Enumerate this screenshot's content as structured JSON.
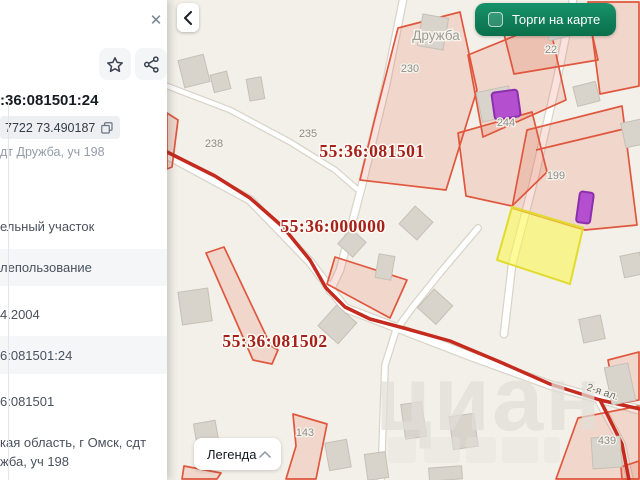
{
  "panel": {
    "title": ":36:081501:24",
    "coords_value": "7722 73.490187",
    "subtitle": "дт Дружба, уч 198",
    "row_type": "ельный участок",
    "row_landuse": "лепользование",
    "row_date": "4.2004",
    "row_cadnum": "6:081501:24",
    "row_quarter": "6:081501",
    "address_line1": "кая область, г Омск, сдт",
    "address_line2": "жба, уч 198"
  },
  "map": {
    "auction_button_label": "Торги на карте",
    "legend_button_label": "Легенда",
    "place_label": "Дружба",
    "street_label": "2-я ал.",
    "watermark": "циан",
    "quarter_labels": {
      "q081501": "55:36:081501",
      "q000000": "55:36:000000",
      "q081502": "55:36:081502"
    },
    "parcel_labels": {
      "p230": "230",
      "p238": "238",
      "p235": "235",
      "p244": "244",
      "p22": "22",
      "p199": "199",
      "p143": "143",
      "p439": "439"
    },
    "colors": {
      "map_background": "#f3f0e9",
      "parcel_stroke": "#e0573e",
      "quarter_boundary": "#c52a1e",
      "quarter_label_text": "#a6211a",
      "selected_parcel_fill": "#f9f68d",
      "selected_parcel_stroke": "#e0dc2e",
      "marker_purple": "#b44fd0",
      "accent_green": "#0e8159",
      "building_fill": "#d8d3cb"
    }
  }
}
